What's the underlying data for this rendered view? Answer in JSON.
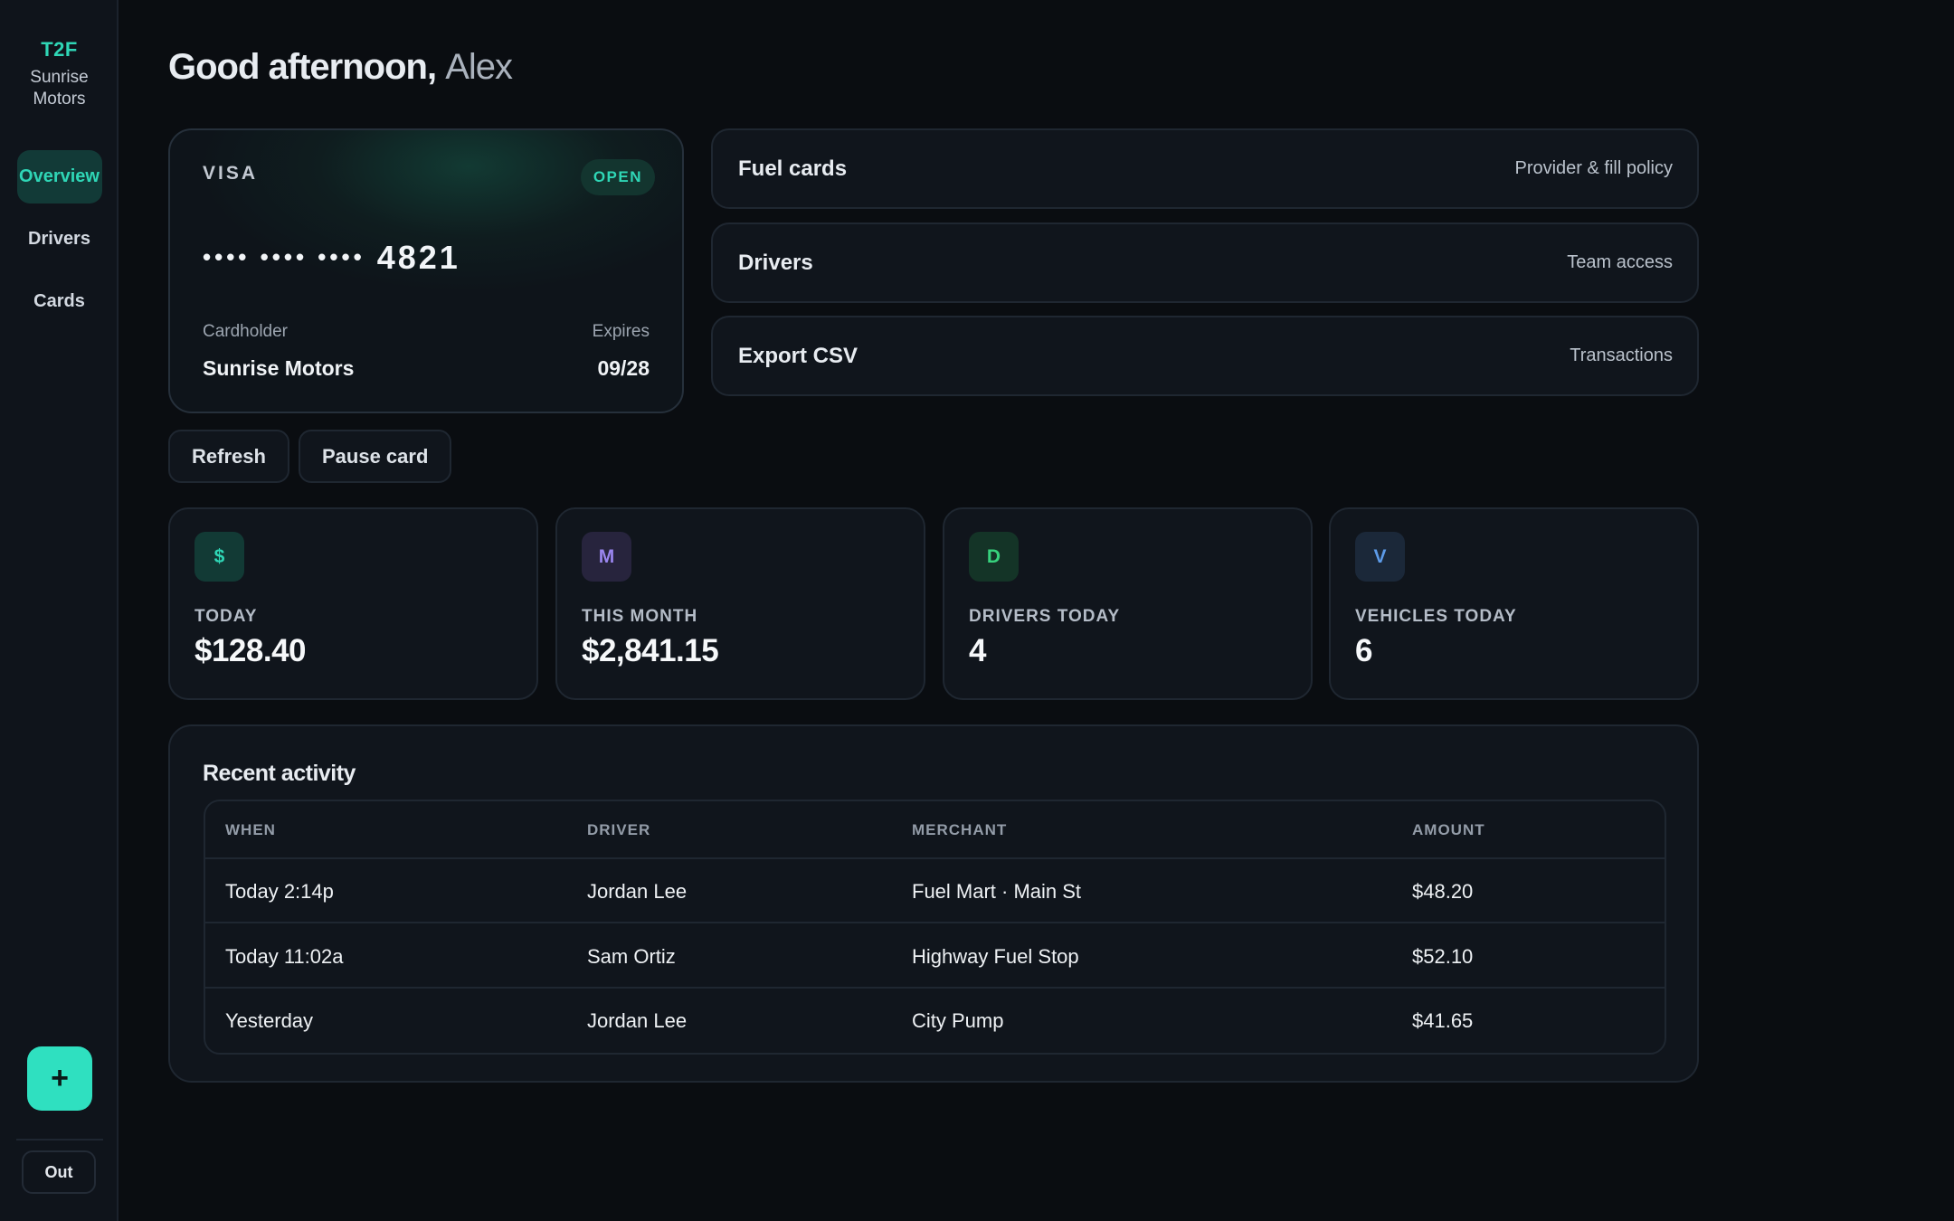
{
  "sidebar": {
    "brand_code": "T2F",
    "brand_name_line1": "Sunrise",
    "brand_name_line2": "Motors",
    "items": [
      {
        "label": "Overview",
        "active": true
      },
      {
        "label": "Drivers",
        "active": false
      },
      {
        "label": "Cards",
        "active": false
      }
    ],
    "fab_label": "+",
    "logout_label": "Out"
  },
  "greeting": {
    "prefix": "Good afternoon,",
    "name": "Alex"
  },
  "card": {
    "network": "VISA",
    "status": "OPEN",
    "masked": "•••• •••• ••••",
    "last4": "4821",
    "holder_label": "Cardholder",
    "holder": "Sunrise Motors",
    "expires_label": "Expires",
    "expires": "09/28"
  },
  "quick_links": [
    {
      "title": "Fuel cards",
      "subtitle": "Provider & fill policy"
    },
    {
      "title": "Drivers",
      "subtitle": "Team access"
    },
    {
      "title": "Export CSV",
      "subtitle": "Transactions"
    }
  ],
  "actions": {
    "refresh": "Refresh",
    "pause": "Pause card"
  },
  "stats": [
    {
      "icon": "$",
      "label": "TODAY",
      "value": "$128.40",
      "icon_bg": "#123a35",
      "icon_color": "#2fd6b6"
    },
    {
      "icon": "M",
      "label": "THIS MONTH",
      "value": "$2,841.15",
      "icon_bg": "#27243d",
      "icon_color": "#9a86ef"
    },
    {
      "icon": "D",
      "label": "DRIVERS TODAY",
      "value": "4",
      "icon_bg": "#143427",
      "icon_color": "#37d27d"
    },
    {
      "icon": "V",
      "label": "VEHICLES TODAY",
      "value": "6",
      "icon_bg": "#1b2839",
      "icon_color": "#5d9be8"
    }
  ],
  "activity": {
    "title": "Recent activity",
    "columns": [
      "WHEN",
      "DRIVER",
      "MERCHANT",
      "AMOUNT"
    ],
    "rows": [
      [
        "Today 2:14p",
        "Jordan Lee",
        "Fuel Mart · Main St",
        "$48.20"
      ],
      [
        "Today 11:02a",
        "Sam Ortiz",
        "Highway Fuel Stop",
        "$52.10"
      ],
      [
        "Yesterday",
        "Jordan Lee",
        "City Pump",
        "$41.65"
      ]
    ]
  },
  "colors": {
    "accent": "#2fd6b6",
    "background": "#0a0d11",
    "panel": "#10151c"
  }
}
